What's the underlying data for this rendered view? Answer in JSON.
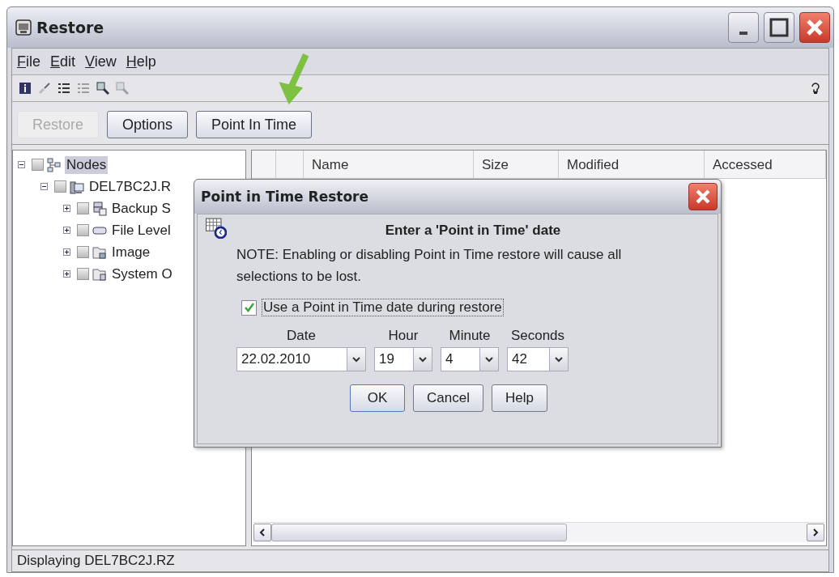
{
  "window": {
    "title": "Restore"
  },
  "menu": [
    "File",
    "Edit",
    "View",
    "Help"
  ],
  "toolbar": [
    {
      "kind": "info",
      "disabled": false
    },
    {
      "kind": "brush",
      "disabled": false
    },
    {
      "kind": "list",
      "disabled": false
    },
    {
      "kind": "list",
      "disabled": true
    },
    {
      "kind": "search",
      "disabled": false
    },
    {
      "kind": "search",
      "disabled": true
    }
  ],
  "buttons": [
    {
      "label": "Restore",
      "disabled": true
    },
    {
      "label": "Options",
      "disabled": false
    },
    {
      "label": "Point In Time",
      "disabled": false
    }
  ],
  "tree": [
    {
      "label": "Nodes",
      "kind": "network",
      "checked": false,
      "expanded": true,
      "selected": true,
      "children": [
        {
          "label": "DEL7BC2J.R",
          "kind": "computer",
          "checked": false,
          "expanded": true,
          "selected": false,
          "children": [
            {
              "label": "Backup S",
              "kind": "backup",
              "checked": false,
              "expanded": false,
              "selected": false
            },
            {
              "label": "File Level",
              "kind": "drive",
              "checked": false,
              "expanded": false,
              "selected": false
            },
            {
              "label": "Image",
              "kind": "image",
              "checked": false,
              "expanded": false,
              "selected": false
            },
            {
              "label": "System O",
              "kind": "system",
              "checked": false,
              "expanded": false,
              "selected": false
            }
          ]
        }
      ]
    }
  ],
  "table": {
    "columns": [
      "Name",
      "Size",
      "Modified",
      "Accessed"
    ]
  },
  "status_bar": "Displaying DEL7BC2J.RZ",
  "dialog": {
    "title": "Point in Time Restore",
    "heading": "Enter a 'Point in Time' date",
    "note": "NOTE: Enabling or disabling Point in Time restore will cause all selections to be lost.",
    "checkbox": {
      "label": "Use a Point in Time date during restore",
      "checked": true
    },
    "fields": [
      {
        "label": "Date",
        "value": "22.02.2010"
      },
      {
        "label": "Hour",
        "value": "19"
      },
      {
        "label": "Minute",
        "value": "4"
      },
      {
        "label": "Seconds",
        "value": "42"
      }
    ],
    "buttons": [
      {
        "label": "OK",
        "default": true
      },
      {
        "label": "Cancel",
        "default": false
      },
      {
        "label": "Help",
        "default": false
      }
    ]
  }
}
